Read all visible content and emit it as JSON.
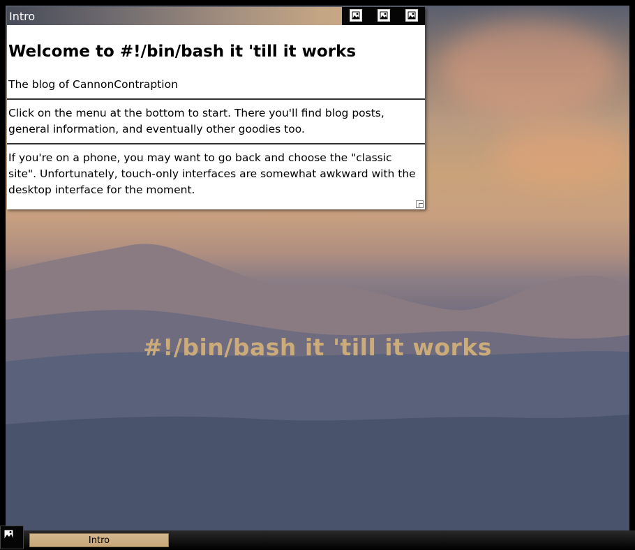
{
  "desktop": {
    "caption": "#!/bin/bash it 'till it works"
  },
  "window": {
    "title": "Intro",
    "heading": "Welcome to #!/bin/bash it 'till it works",
    "paragraphs": [
      "The blog of CannonContraption",
      "Click on the menu at the bottom to start. There you'll find blog posts, general information, and eventually other goodies too.",
      "If you're on a phone, you may want to go back and choose the \"classic site\". Unfortunately, touch-only interfaces are somewhat awkward with the desktop interface for the moment."
    ],
    "controls": [
      "minimize-icon",
      "maximize-icon",
      "close-icon"
    ]
  },
  "taskbar": {
    "start_icon": "image-icon",
    "tasks": [
      {
        "label": "Intro"
      }
    ]
  },
  "colors": {
    "window_bg": "#ffffff",
    "taskbar_task": "#c9a87b",
    "caption": "#d5b27a"
  }
}
